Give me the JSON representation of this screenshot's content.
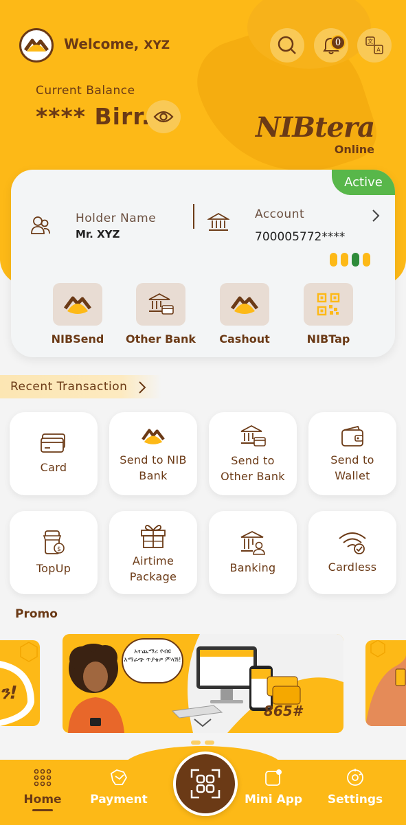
{
  "header": {
    "welcome_prefix": "Welcome,",
    "user_name": "XYZ",
    "notification_count": "0",
    "balance_label": "Current Balance",
    "balance_value": "**** Birr.",
    "brand_name": "NIBtera",
    "brand_sub": "Online"
  },
  "account_card": {
    "status": "Active",
    "holder_label": "Holder Name",
    "holder_name": "Mr. XYZ",
    "account_label": "Account",
    "account_number": "700005772****",
    "quick_actions": [
      {
        "label": "NIBSend",
        "icon": "nib-logo-icon"
      },
      {
        "label": "Other Bank",
        "icon": "bank-card-icon"
      },
      {
        "label": "Cashout",
        "icon": "nib-logo-icon"
      },
      {
        "label": "NIBTap",
        "icon": "qr-code-icon"
      }
    ]
  },
  "recent_transaction": {
    "label": "Recent Transaction"
  },
  "services": [
    {
      "label": "Card",
      "icon": "credit-card-icon"
    },
    {
      "label": "Send to NIB\nBank",
      "icon": "nib-logo-icon"
    },
    {
      "label": "Send to\nOther Bank",
      "icon": "bank-card-icon"
    },
    {
      "label": "Send to\nWallet",
      "icon": "wallet-icon"
    },
    {
      "label": "TopUp",
      "icon": "phone-topup-icon"
    },
    {
      "label": "Airtime\nPackage",
      "icon": "gift-icon"
    },
    {
      "label": "Banking",
      "icon": "bank-user-icon"
    },
    {
      "label": "Cardless",
      "icon": "wifi-check-icon"
    }
  ],
  "promo": {
    "title": "Promo",
    "bubble_text": "አተጨማሪ የብዩ አማራጭ ጥያቄዎ ምላሽ!",
    "ussd_code": "865#",
    "side_left_text": "ን!"
  },
  "bottom_nav": [
    {
      "label": "Home",
      "icon": "grid-dots-icon",
      "selected": true
    },
    {
      "label": "Payment",
      "icon": "payment-icon",
      "selected": false
    },
    {
      "label": "Mini App",
      "icon": "mini-app-icon",
      "selected": false
    },
    {
      "label": "Settings",
      "icon": "settings-icon",
      "selected": false
    }
  ],
  "colors": {
    "primary": "#fdb917",
    "brown": "#6b3a16",
    "active_green": "#58b74a",
    "background": "#f4f4f4"
  }
}
